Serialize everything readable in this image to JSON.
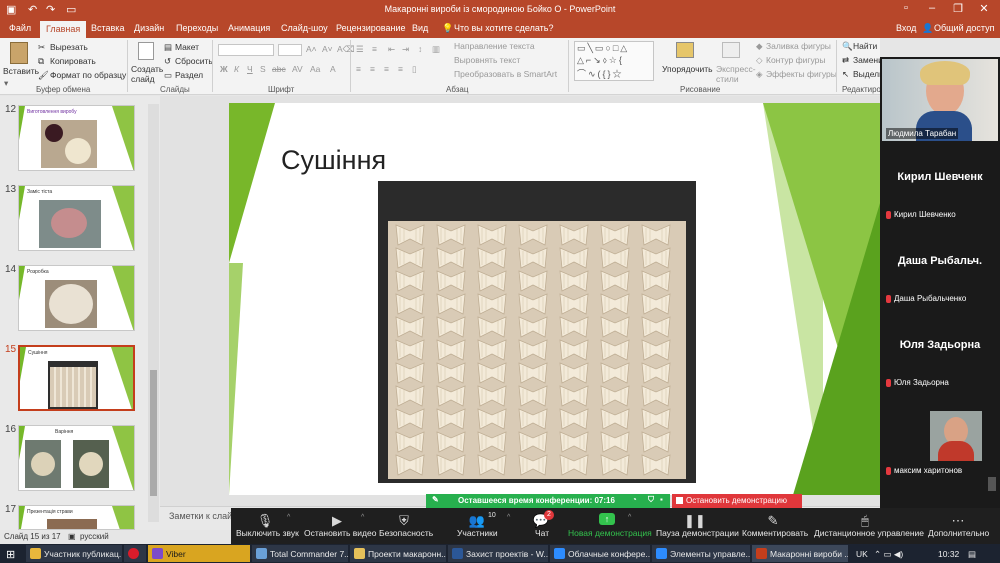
{
  "window": {
    "title": "Макаронні вироби із смородиною Бойко О - PowerPoint",
    "signin": "Вход",
    "share": "Общий доступ"
  },
  "tabs": [
    "Файл",
    "Главная",
    "Вставка",
    "Дизайн",
    "Переходы",
    "Анимация",
    "Слайд-шоу",
    "Рецензирование",
    "Вид"
  ],
  "tell_me": "Что вы хотите сделать?",
  "ribbon": {
    "paste": "Вставить",
    "cut": "Вырезать",
    "copy": "Копировать",
    "format_painter": "Формат по образцу",
    "clipboard_group": "Буфер обмена",
    "new_slide": "Создать слайд",
    "layout": "Макет",
    "reset": "Сбросить",
    "section": "Раздел",
    "slides_group": "Слайды",
    "font_group": "Шрифт",
    "text_direction": "Направление текста",
    "align_text": "Выровнять текст",
    "smartart": "Преобразовать в SmartArt",
    "paragraph_group": "Абзац",
    "arrange": "Упорядочить",
    "quick_styles": "Экспресс-стили",
    "shape_fill": "Заливка фигуры",
    "shape_outline": "Контур фигуры",
    "shape_effects": "Эффекты фигуры",
    "drawing_group": "Рисование",
    "find": "Найти",
    "replace": "Замени",
    "select": "Выдели",
    "editing_group": "Редактиро"
  },
  "thumbnails": [
    {
      "num": "12",
      "title": "Виготовлення виробу",
      "selected": false
    },
    {
      "num": "13",
      "title": "Заміс тіста",
      "selected": false
    },
    {
      "num": "14",
      "title": "Розробка",
      "selected": false
    },
    {
      "num": "15",
      "title": "Сушіння",
      "selected": true
    },
    {
      "num": "16",
      "title": "Варіння",
      "selected": false
    },
    {
      "num": "17",
      "title": "Презентація страви",
      "selected": false
    }
  ],
  "slide": {
    "title": "Сушіння"
  },
  "notes_placeholder": "Заметки к слай",
  "status": {
    "slide_info": "Слайд 15 из 17",
    "language": "русский"
  },
  "participants": [
    {
      "display": "",
      "name": "Людмила Тарабан",
      "video": true
    },
    {
      "display": "Кирил Шевченк",
      "name": "Кирил Шевченко",
      "video": false
    },
    {
      "display": "Даша  Рыбальч.",
      "name": "Даша Рыбальченко",
      "video": false
    },
    {
      "display": "Юля Задьорна",
      "name": "Юля Задьорна",
      "video": false
    },
    {
      "display": "",
      "name": "максим харитонов",
      "video": true
    }
  ],
  "meeting": {
    "time_left": "Оставшееся время конференции: 07:16",
    "stop_share": "Остановить демонстрацию",
    "participants_count": "10",
    "chat_badge": "2",
    "buttons": [
      "Выключить звук",
      "Остановить видео",
      "Безопасность",
      "Участники",
      "Чат",
      "Новая демонстрация",
      "Пауза демонстрации",
      "Комментировать",
      "Дистанционное управление",
      "Дополнительно"
    ]
  },
  "taskbar": {
    "items": [
      "Участник публикац...",
      "",
      "Viber",
      "Total Commander 7....",
      "Проекти макаронн...",
      "Захист проектів - W...",
      "Облачные конфере...",
      "Элементы управле...",
      "Макаронні вироби ..."
    ],
    "lang": "UK",
    "time": "10:32"
  },
  "colors": {
    "ppt_accent": "#b7472a",
    "slide_green": "#8cc544",
    "zoom_green": "#27b04e",
    "zoom_red": "#e0373b"
  }
}
